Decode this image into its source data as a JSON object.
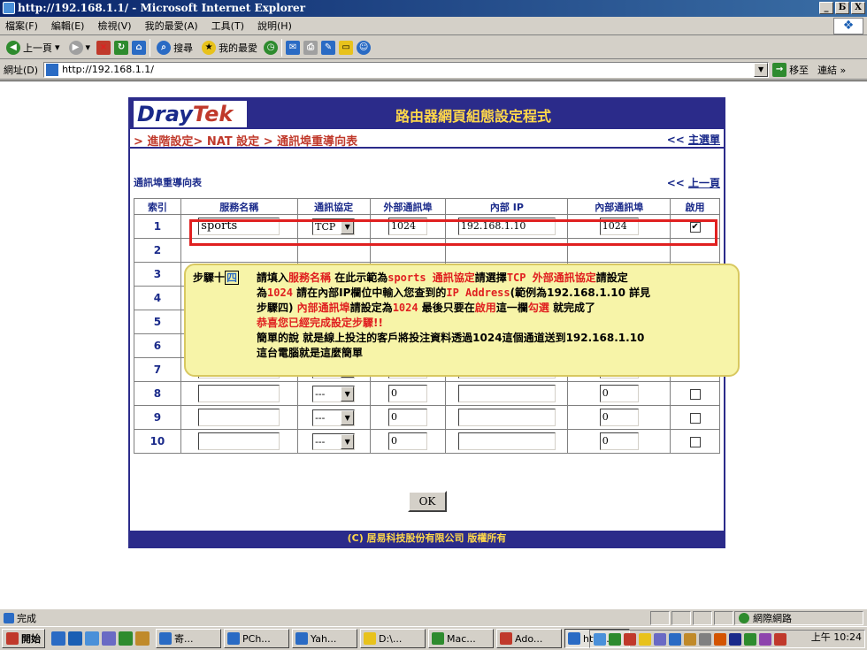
{
  "window": {
    "title": "http://192.168.1.1/ - Microsoft Internet Explorer",
    "min": "_",
    "max": "Б",
    "close": "X"
  },
  "menu": [
    "檔案(F)",
    "編輯(E)",
    "檢視(V)",
    "我的最愛(A)",
    "工具(T)",
    "說明(H)"
  ],
  "toolbar": {
    "back": "上一頁",
    "search": "搜尋",
    "favorites": "我的最愛"
  },
  "address": {
    "label": "網址(D)",
    "url": "http://192.168.1.1/",
    "go": "移至",
    "links": "連結 »"
  },
  "page": {
    "logo_dray": "Dray",
    "logo_tek": "Tek",
    "title": "路由器網頁組態設定程式",
    "breadcrumb": "> 進階設定> NAT 設定 > 通訊埠重導向表",
    "main_menu_prefix": "<< ",
    "main_menu": "主選單",
    "section_title": "通訊埠重導向表",
    "prev_prefix": "<< ",
    "prev_page": "上一頁",
    "columns": [
      "索引",
      "服務名稱",
      "通訊協定",
      "外部通訊埠",
      "內部 IP",
      "內部通訊埠",
      "啟用"
    ],
    "rows": [
      {
        "index": "1",
        "name": "sports",
        "protocol": "TCP",
        "ext_port": "1024",
        "ip": "192.168.1.10",
        "int_port": "1024",
        "enabled": "✔"
      },
      {
        "index": "2"
      },
      {
        "index": "3"
      },
      {
        "index": "4"
      },
      {
        "index": "5"
      },
      {
        "index": "6"
      },
      {
        "index": "7",
        "name": "",
        "protocol": "---",
        "ext_port": "0",
        "ip": "",
        "int_port": "0",
        "enabled": ""
      },
      {
        "index": "8",
        "name": "",
        "protocol": "---",
        "ext_port": "0",
        "ip": "",
        "int_port": "0",
        "enabled": ""
      },
      {
        "index": "9",
        "name": "",
        "protocol": "---",
        "ext_port": "0",
        "ip": "",
        "int_port": "0",
        "enabled": ""
      },
      {
        "index": "10",
        "name": "",
        "protocol": "---",
        "ext_port": "0",
        "ip": "",
        "int_port": "0",
        "enabled": ""
      }
    ],
    "ok": "OK",
    "footer": "(C) 居易科技股份有限公司 版權所有"
  },
  "callout": {
    "step_prefix": "步驟十",
    "step_num": "四",
    "l1_a": "請填入",
    "l1_b": "服務名稱",
    "l1_c": " 在此示範為",
    "l1_d": "sports 通訊協定",
    "l1_e": "請選擇",
    "l1_f": "TCP 外部通訊協定",
    "l1_g": "請設定",
    "l2_a": "為",
    "l2_b": "1024",
    "l2_c": " 請在內部IP欄位中輸入您查到的",
    "l2_d": "IP Address",
    "l2_e": "(範例為192.168.1.10 詳見",
    "l3_a": "步驟四) ",
    "l3_b": "內部通訊埠",
    "l3_c": "請設定為",
    "l3_d": "1024",
    "l3_e": " 最後只要在",
    "l3_f": "啟用",
    "l3_g": "這一欄",
    "l3_h": "勾選",
    "l3_i": " 就完成了",
    "l4": "恭喜您已經完成設定步驟!!",
    "l5": "簡單的說 就是線上投注的客戶將投注資料透過1024這個通道送到192.168.1.10",
    "l6": "這台電腦就是這麼簡單"
  },
  "status": {
    "text": "完成",
    "zone": "網際網路"
  },
  "taskbar": {
    "start": "開始",
    "tasks": [
      "寄...",
      "PCh...",
      "Yah...",
      "D:\\...",
      "Mac...",
      "Ado...",
      "http:..."
    ],
    "clock": "上午 10:24"
  },
  "colors": {
    "navy": "#2b2b8a",
    "gold": "#ffd84a",
    "red": "#e02020",
    "note": "#f7f4a8"
  }
}
